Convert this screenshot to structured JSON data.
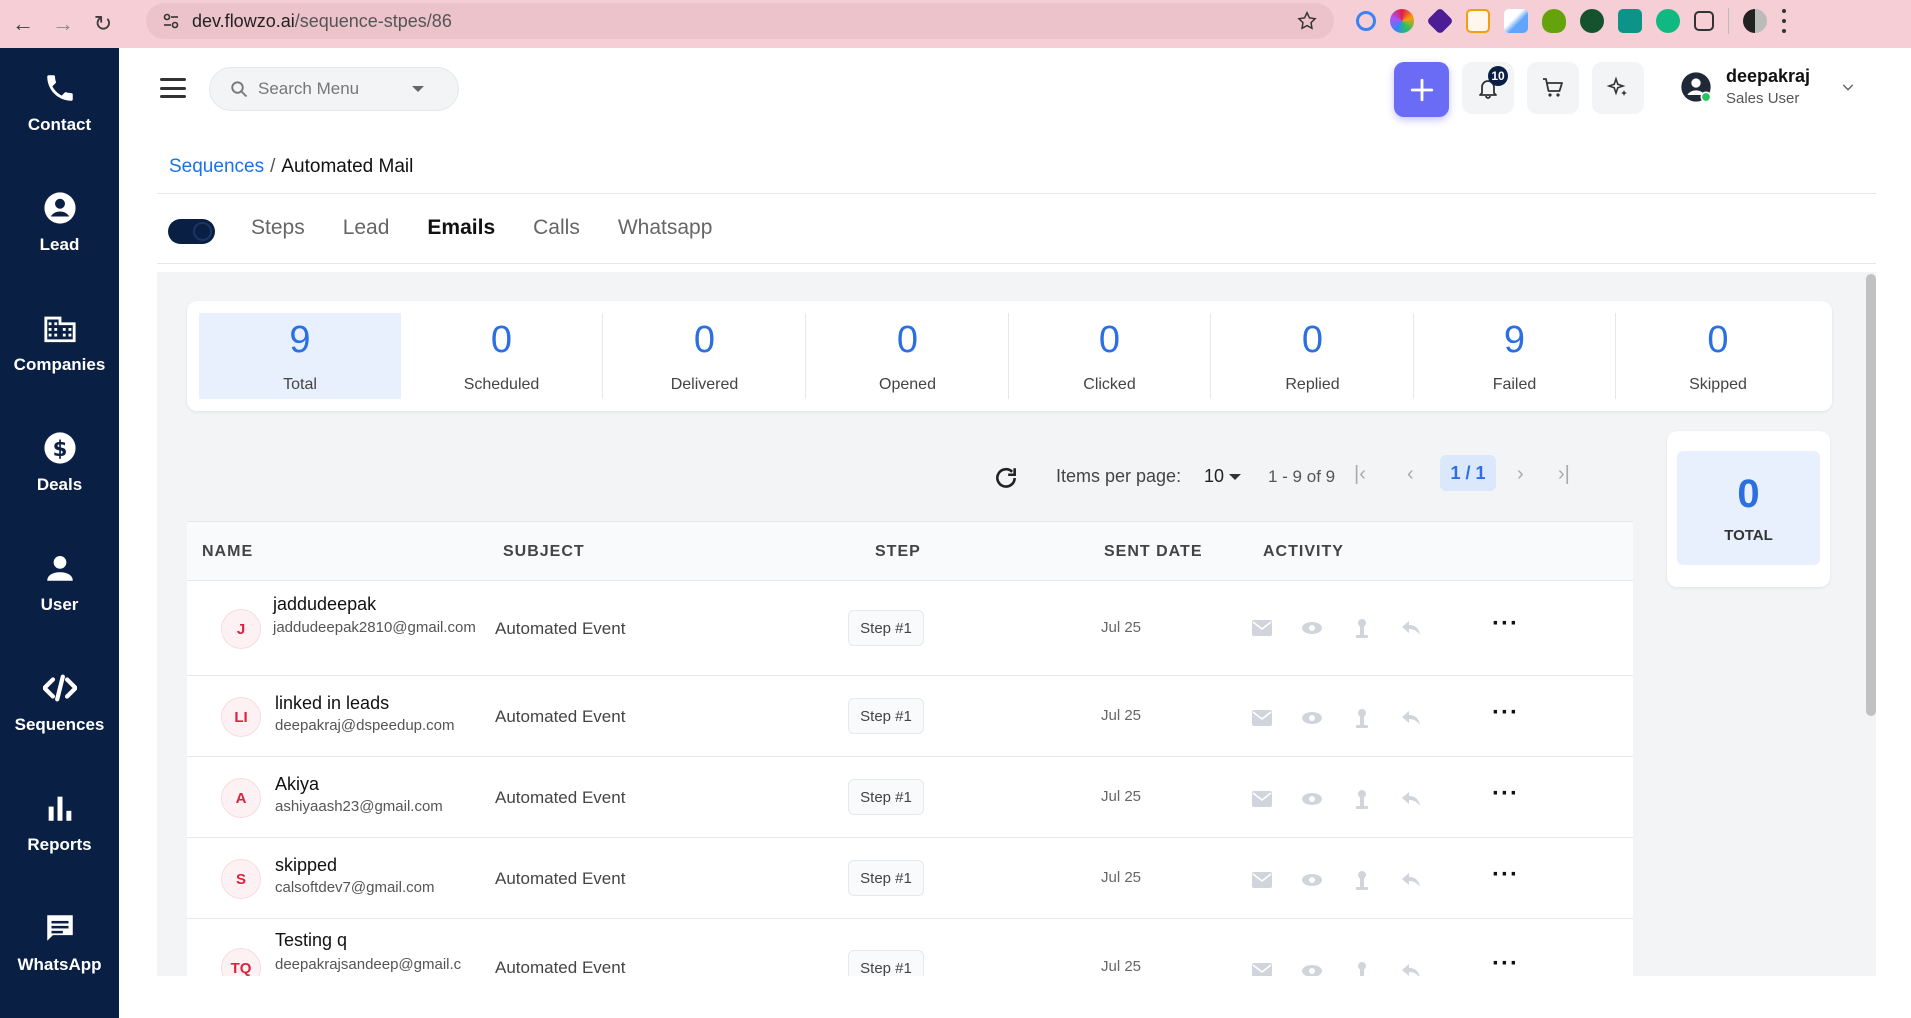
{
  "browser": {
    "url_host": "dev.flowzo.ai",
    "url_path": "/sequence-stpes/86"
  },
  "sidebar": {
    "items": [
      {
        "label": "Contact",
        "icon": "phone-icon"
      },
      {
        "label": "Lead",
        "icon": "user-circle-icon"
      },
      {
        "label": "Companies",
        "icon": "building-icon"
      },
      {
        "label": "Deals",
        "icon": "dollar-icon"
      },
      {
        "label": "User",
        "icon": "person-icon"
      },
      {
        "label": "Sequences",
        "icon": "code-icon"
      },
      {
        "label": "Reports",
        "icon": "bar-chart-icon"
      },
      {
        "label": "WhatsApp",
        "icon": "message-icon"
      }
    ]
  },
  "header": {
    "search_placeholder": "Search Menu",
    "notification_count": "10",
    "user_name": "deepakraj",
    "user_role": "Sales User"
  },
  "breadcrumb": {
    "parent": "Sequences",
    "separator": "/",
    "current": "Automated Mail"
  },
  "tabs": [
    "Steps",
    "Lead",
    "Emails",
    "Calls",
    "Whatsapp"
  ],
  "active_tab": "Emails",
  "stats": [
    {
      "value": "9",
      "label": "Total"
    },
    {
      "value": "0",
      "label": "Scheduled"
    },
    {
      "value": "0",
      "label": "Delivered"
    },
    {
      "value": "0",
      "label": "Opened"
    },
    {
      "value": "0",
      "label": "Clicked"
    },
    {
      "value": "0",
      "label": "Replied"
    },
    {
      "value": "9",
      "label": "Failed"
    },
    {
      "value": "0",
      "label": "Skipped"
    }
  ],
  "pagination": {
    "items_per_page_label": "Items per page:",
    "items_per_page": "10",
    "range": "1 - 9 of 9",
    "page": "1 / 1"
  },
  "table": {
    "headers": [
      "NAME",
      "SUBJECT",
      "STEP",
      "SENT DATE",
      "ACTIVITY"
    ],
    "rows": [
      {
        "initials": "J",
        "name": "jaddudeepak",
        "email": "jaddudeepak2810@gmail.com",
        "subject": "Automated Event",
        "step": "Step #1",
        "date": "Jul 25"
      },
      {
        "initials": "LI",
        "name": "linked in leads",
        "email": "deepakraj@dspeedup.com",
        "subject": "Automated Event",
        "step": "Step #1",
        "date": "Jul 25"
      },
      {
        "initials": "A",
        "name": "Akiya",
        "email": "ashiyaash23@gmail.com",
        "subject": "Automated Event",
        "step": "Step #1",
        "date": "Jul 25"
      },
      {
        "initials": "S",
        "name": "skipped",
        "email": "calsoftdev7@gmail.com",
        "subject": "Automated Event",
        "step": "Step #1",
        "date": "Jul 25"
      },
      {
        "initials": "TQ",
        "name": "Testing q",
        "email": "deepakrajsandeep@gmail.c",
        "subject": "Automated Event",
        "step": "Step #1",
        "date": "Jul 25"
      }
    ]
  },
  "total_card": {
    "value": "0",
    "label": "TOTAL"
  },
  "colors": {
    "sidebar_bg": "#0a1f44",
    "accent": "#6b6cf5",
    "stat_blue": "#2b6fe0",
    "browser_bar": "#f6cfd6"
  }
}
